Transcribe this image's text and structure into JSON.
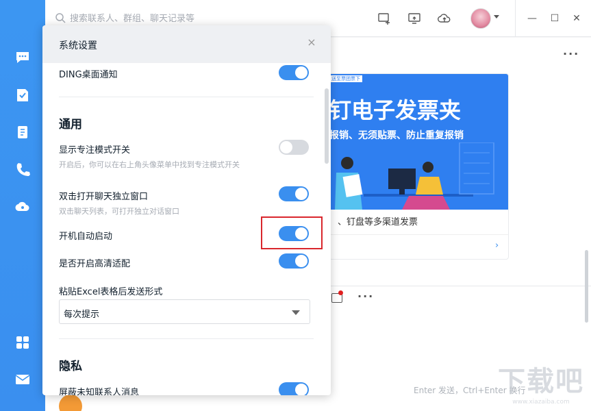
{
  "search": {
    "placeholder": "搜索联系人、群组、聊天记录等"
  },
  "chat": {
    "banner_tag": "送至票团票下",
    "banner_title": "钉电子发票夹",
    "banner_subtitle": "报销、无须贴票、防止重复报销",
    "card_text": "、钉盘等多渠道发票",
    "input_hint": "Enter 发送，Ctrl+Enter 换行"
  },
  "watermark": {
    "title": "下载吧",
    "url": "www.xiazaiba.com"
  },
  "dialog": {
    "title": "系统设置",
    "close": "×",
    "settings": {
      "ding_label": "DING桌面通知",
      "ding_on": true,
      "general_section": "通用",
      "focus_label": "显示专注模式开关",
      "focus_desc": "开启后，你可以在右上角头像菜单中找到专注模式开关",
      "focus_on": false,
      "dblclick_label": "双击打开聊天独立窗口",
      "dblclick_desc": "双击聊天列表，可打开独立对话窗口",
      "dblclick_on": true,
      "autostart_label": "开机自动启动",
      "autostart_on": true,
      "hidpi_label": "是否开启高清适配",
      "hidpi_on": true,
      "excel_label": "粘贴Excel表格后发送形式",
      "excel_value": "每次提示",
      "privacy_section": "隐私",
      "block_label": "屏蔽未知联系人消息",
      "block_on": true
    }
  },
  "colors": {
    "accent": "#3a8fef",
    "sidebar": "#3c96f2",
    "highlight": "#d9262c"
  }
}
